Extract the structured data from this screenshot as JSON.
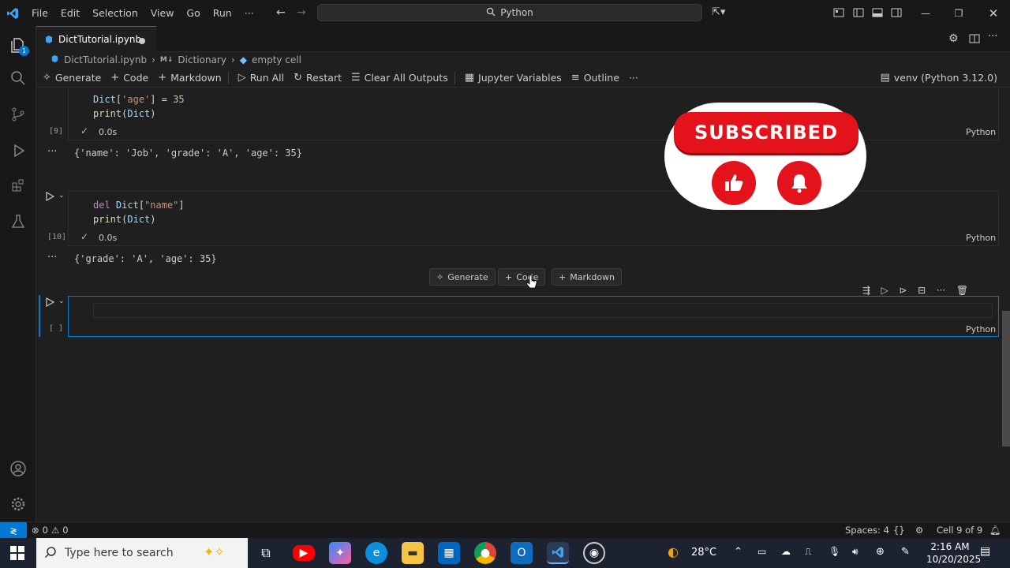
{
  "titlebar": {
    "menus": [
      "File",
      "Edit",
      "Selection",
      "View",
      "Go",
      "Run"
    ],
    "more": "···",
    "search_text": "Python"
  },
  "tab": {
    "title": "DictTutorial.ipynb"
  },
  "breadcrumb": {
    "file": "DictTutorial.ipynb",
    "section_prefix": "M↓",
    "section": "Dictionary",
    "cell": "empty cell"
  },
  "toolbar": {
    "generate": "Generate",
    "code": "Code",
    "markdown": "Markdown",
    "run_all": "Run All",
    "restart": "Restart",
    "clear": "Clear All Outputs",
    "variables": "Jupyter Variables",
    "outline": "Outline",
    "more": "···",
    "kernel": "venv (Python 3.12.0)"
  },
  "cells": [
    {
      "exec": "[9]",
      "duration": "0.0s",
      "lang": "Python",
      "line1_var": "Dict",
      "line1_key": "'age'",
      "line1_rest": "] = ",
      "line1_num": "35",
      "line2_fn": "print",
      "line2_var": "Dict",
      "output": "{'name': 'Job', 'grade': 'A', 'age': 35}"
    },
    {
      "exec": "[10]",
      "duration": "0.0s",
      "lang": "Python",
      "line1_kw": "del",
      "line1_var": "Dict",
      "line1_key": "\"name\"",
      "line2_fn": "print",
      "line2_var": "Dict",
      "output": "{'grade': 'A', 'age': 35}"
    },
    {
      "exec": "[ ]",
      "lang": "Python"
    }
  ],
  "insert_bar": {
    "generate": "Generate",
    "code": "Code",
    "markdown": "Markdown"
  },
  "subscribe": {
    "label": "SUBSCRIBED"
  },
  "status": {
    "errors": "0",
    "warnings": "0",
    "spaces": "Spaces: 4",
    "braces": "{}",
    "cell": "Cell 9 of 9"
  },
  "taskbar": {
    "search_placeholder": "Type here to search",
    "weather": "28°C",
    "time": "2:16 AM",
    "date": "10/20/2025"
  }
}
